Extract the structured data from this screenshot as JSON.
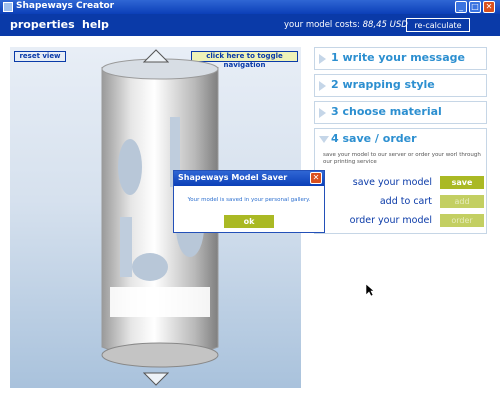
{
  "window": {
    "title": "Shapeways Creator"
  },
  "menu": {
    "properties": "properties",
    "help": "help",
    "cost_label": "your model costs:",
    "cost_value": "88,45 USD",
    "recalc": "re-calculate"
  },
  "viewport": {
    "reset_view": "reset view",
    "toggle_nav": "click here to toggle navigation"
  },
  "steps": [
    {
      "label": "1 write your message"
    },
    {
      "label": "2 wrapping style"
    },
    {
      "label": "3 choose material"
    },
    {
      "label": "4 save / order",
      "desc": "save your model to our server or order your worl through our printing service"
    }
  ],
  "actions": [
    {
      "label": "save your model",
      "button": "save"
    },
    {
      "label": "add to cart",
      "button": "add"
    },
    {
      "label": "order your model",
      "button": "order"
    }
  ],
  "dialog": {
    "title": "Shapeways Model Saver",
    "message": "Your model is saved in your personal gallery.",
    "ok": "ok"
  },
  "colors": {
    "brand_blue": "#0a3aa8",
    "accent_green": "#aab924",
    "step_blue": "#2c8fd0"
  }
}
